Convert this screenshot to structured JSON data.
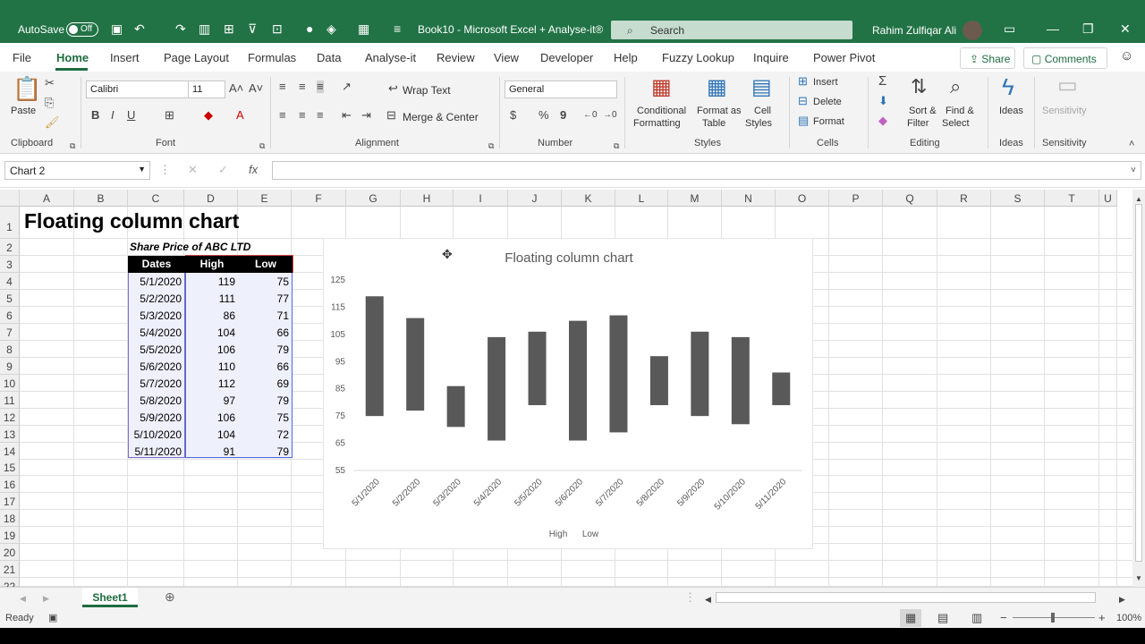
{
  "titlebar": {
    "autosave_label": "AutoSave",
    "autosave_state": "Off",
    "doc_title": "Book10  -  Microsoft Excel + Analyse-it®",
    "search_placeholder": "Search",
    "user_name": "Rahim Zulfiqar Ali"
  },
  "tabs": [
    "File",
    "Home",
    "Insert",
    "Page Layout",
    "Formulas",
    "Data",
    "Analyse-it",
    "Review",
    "View",
    "Developer",
    "Help",
    "Fuzzy Lookup",
    "Inquire",
    "Power Pivot"
  ],
  "share_label": "Share",
  "comments_label": "Comments",
  "ribbon": {
    "clipboard": {
      "paste": "Paste",
      "group": "Clipboard"
    },
    "font": {
      "name": "Calibri",
      "size": "11",
      "group": "Font",
      "bold": "B",
      "italic": "I",
      "underline": "U"
    },
    "alignment": {
      "wrap_text": "Wrap Text",
      "merge_center": "Merge & Center",
      "group": "Alignment"
    },
    "number": {
      "format": "General",
      "group": "Number"
    },
    "styles": {
      "conditional": "Conditional",
      "conditional2": "Formatting",
      "format_as": "Format as",
      "format_as2": "Table",
      "cell": "Cell",
      "cell2": "Styles",
      "group": "Styles"
    },
    "cells": {
      "insert": "Insert",
      "delete": "Delete",
      "format": "Format",
      "group": "Cells"
    },
    "editing": {
      "sort": "Sort &",
      "sort2": "Filter",
      "find": "Find &",
      "find2": "Select",
      "group": "Editing"
    },
    "ideas": {
      "label": "Ideas",
      "group": "Ideas"
    },
    "sensitivity": {
      "label": "Sensitivity",
      "group": "Sensitivity"
    }
  },
  "formula_bar": {
    "name_box": "Chart 2",
    "fx": "fx",
    "formula": ""
  },
  "columns": [
    "A",
    "B",
    "C",
    "D",
    "E",
    "F",
    "G",
    "H",
    "I",
    "J",
    "K",
    "L",
    "M",
    "N",
    "O",
    "P",
    "Q",
    "R",
    "S",
    "T",
    "U"
  ],
  "rows": [
    "1",
    "2",
    "3",
    "4",
    "5",
    "6",
    "7",
    "8",
    "9",
    "10",
    "11",
    "12",
    "13",
    "14",
    "15",
    "16",
    "17",
    "18",
    "19",
    "20",
    "21",
    "22"
  ],
  "sheet": {
    "title": "Floating column chart",
    "subtitle": "Share Price of ABC LTD",
    "headers": [
      "Dates",
      "High",
      "Low"
    ],
    "table": [
      [
        "5/1/2020",
        "119",
        "75"
      ],
      [
        "5/2/2020",
        "111",
        "77"
      ],
      [
        "5/3/2020",
        "86",
        "71"
      ],
      [
        "5/4/2020",
        "104",
        "66"
      ],
      [
        "5/5/2020",
        "106",
        "79"
      ],
      [
        "5/6/2020",
        "110",
        "66"
      ],
      [
        "5/7/2020",
        "112",
        "69"
      ],
      [
        "5/8/2020",
        "97",
        "79"
      ],
      [
        "5/9/2020",
        "106",
        "75"
      ],
      [
        "5/10/2020",
        "104",
        "72"
      ],
      [
        "5/11/2020",
        "91",
        "79"
      ]
    ]
  },
  "chart_data": {
    "type": "bar",
    "title": "Floating column chart",
    "categories": [
      "5/1/2020",
      "5/2/2020",
      "5/3/2020",
      "5/4/2020",
      "5/5/2020",
      "5/6/2020",
      "5/7/2020",
      "5/8/2020",
      "5/9/2020",
      "5/10/2020",
      "5/11/2020"
    ],
    "series": [
      {
        "name": "High",
        "values": [
          119,
          111,
          86,
          104,
          106,
          110,
          112,
          97,
          106,
          104,
          91
        ]
      },
      {
        "name": "Low",
        "values": [
          75,
          77,
          71,
          66,
          79,
          66,
          69,
          79,
          75,
          72,
          79
        ]
      }
    ],
    "yticks": [
      "125",
      "115",
      "105",
      "95",
      "85",
      "75",
      "65",
      "55"
    ],
    "ylim": [
      55,
      125
    ],
    "bar_color": "#595959",
    "legend": "bottom",
    "grid": false
  },
  "sheet_tab": "Sheet1",
  "status": {
    "ready": "Ready",
    "zoom": "100%"
  }
}
